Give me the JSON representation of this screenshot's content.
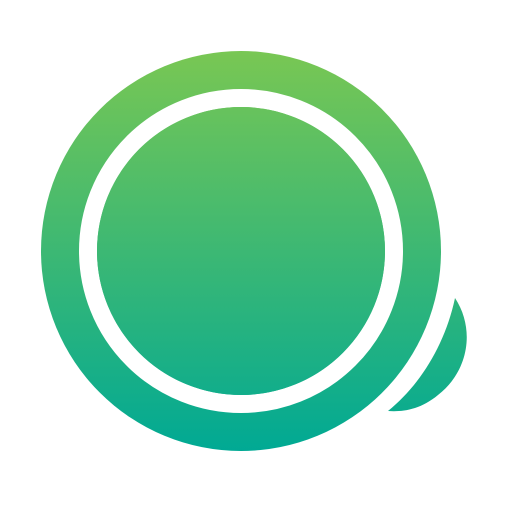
{
  "logo": {
    "icon_name": "chat-bubble-ring-logo",
    "colors": {
      "gradient_top": "#79C753",
      "gradient_bottom": "#00A994",
      "ring_gap": "#FFFFFF",
      "background": "#FFFFFF"
    }
  }
}
